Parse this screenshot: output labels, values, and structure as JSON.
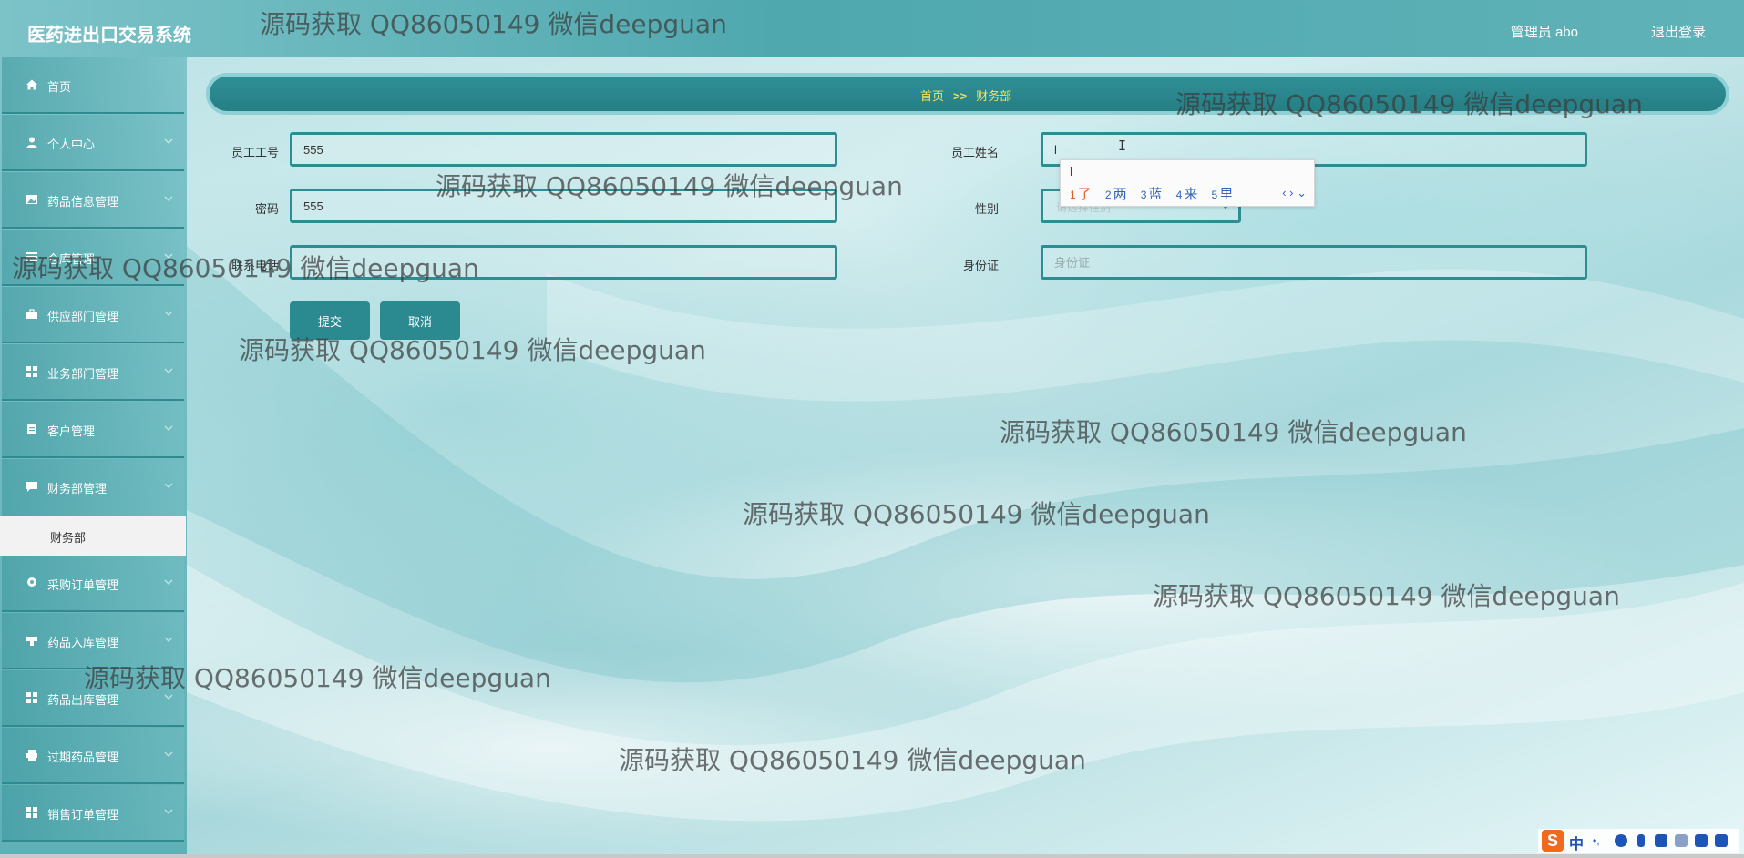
{
  "header": {
    "app_title": "医药进出口交易系统",
    "user_label": "管理员 abo",
    "logout_label": "退出登录"
  },
  "sidebar": {
    "items": [
      {
        "label": "首页",
        "icon": "home-icon"
      },
      {
        "label": "个人中心",
        "icon": "user-icon"
      },
      {
        "label": "药品信息管理",
        "icon": "image-icon"
      },
      {
        "label": "仓库管理",
        "icon": "list-icon"
      },
      {
        "label": "供应部门管理",
        "icon": "briefcase-icon"
      },
      {
        "label": "业务部门管理",
        "icon": "grid-icon"
      },
      {
        "label": "客户管理",
        "icon": "clipboard-icon"
      },
      {
        "label": "财务部管理",
        "icon": "chat-icon"
      },
      {
        "label": "采购订单管理",
        "icon": "pin-icon"
      },
      {
        "label": "药品入库管理",
        "icon": "stamp-icon"
      },
      {
        "label": "药品出库管理",
        "icon": "grid-icon"
      },
      {
        "label": "过期药品管理",
        "icon": "printer-icon"
      },
      {
        "label": "销售订单管理",
        "icon": "grid-icon"
      }
    ],
    "active_submenu": "财务部"
  },
  "breadcrumb": {
    "home": "首页",
    "separator": ">>",
    "current": "财务部"
  },
  "form": {
    "employee_id_label": "员工工号",
    "employee_id_value": "555",
    "employee_name_label": "员工姓名",
    "employee_name_value": "l",
    "password_label": "密码",
    "password_value": "555",
    "gender_label": "性别",
    "gender_placeholder": "请选择性别",
    "phone_label": "联系电话",
    "phone_placeholder": "",
    "id_card_label": "身份证",
    "id_card_placeholder": "身份证",
    "submit_label": "提交",
    "cancel_label": "取消"
  },
  "ime": {
    "composition": "l",
    "candidates": [
      {
        "num": "1",
        "text": "了"
      },
      {
        "num": "2",
        "text": "两"
      },
      {
        "num": "3",
        "text": "蓝"
      },
      {
        "num": "4",
        "text": "来"
      },
      {
        "num": "5",
        "text": "里"
      }
    ],
    "nav": "‹ › ⌄"
  },
  "watermark_text": "源码获取 QQ86050149 微信deepguan",
  "tray": {
    "ime_logo": "S",
    "ime_lang": "中"
  },
  "colors": {
    "accent": "#2b8a90",
    "breadcrumb_text": "#f3e35b",
    "sidebar": "#5fb0b6"
  }
}
